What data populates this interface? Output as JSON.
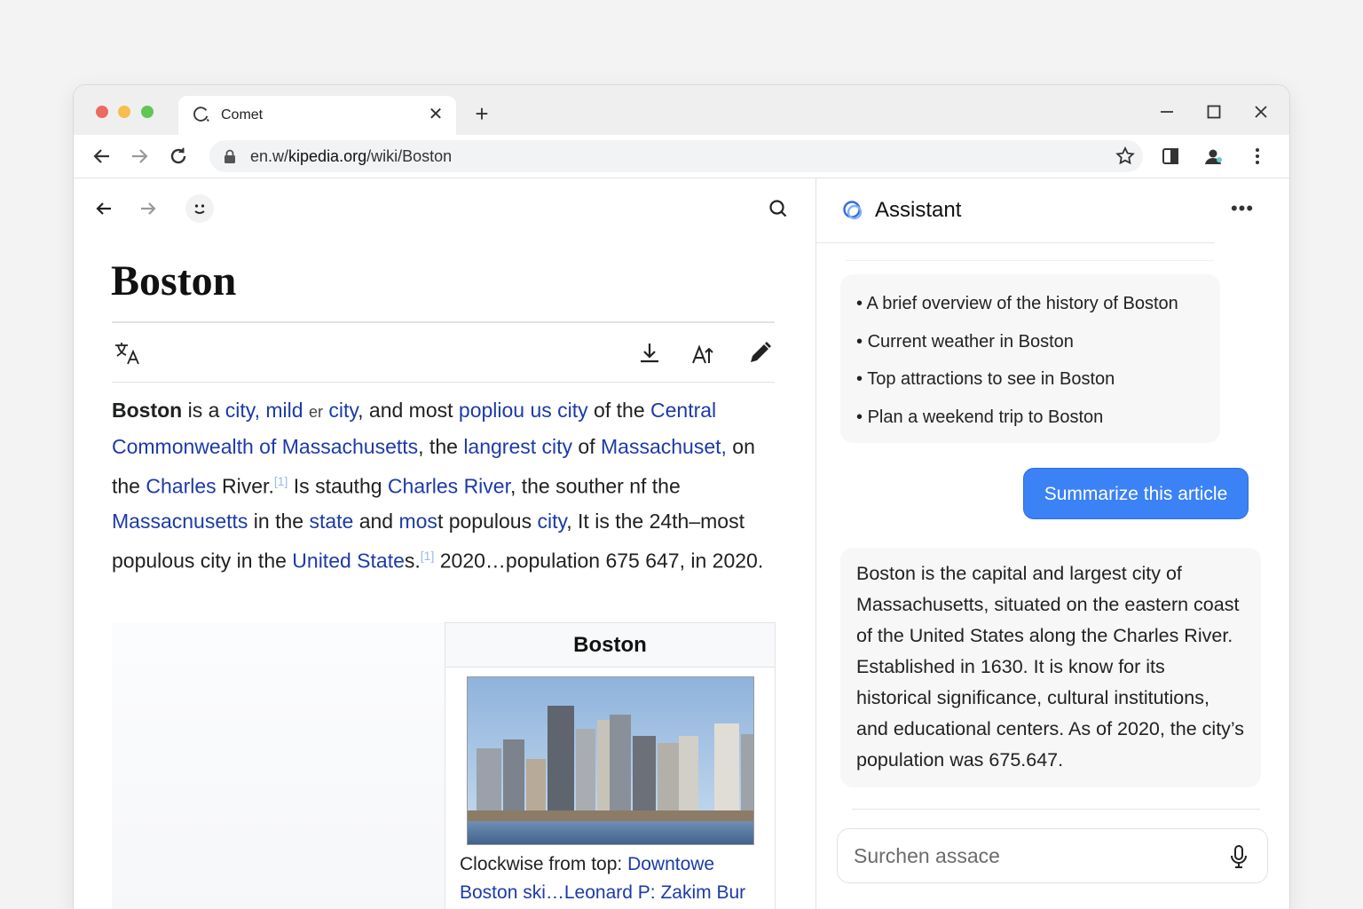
{
  "browser": {
    "tab_title": "Comet",
    "url_prefix": "en.w/",
    "url_domain": "kipedia.org",
    "url_path": "/wiki/Boston"
  },
  "article": {
    "title": "Boston",
    "p": [
      "Boston",
      " is a ",
      "city, mild",
      " ",
      "er",
      " ",
      "city",
      ", and most ",
      "popliou us city",
      " of the ",
      "Central Commonwealth of Massachusetts",
      ", the ",
      "langrest city",
      " of ",
      "Massachuset,",
      " on the ",
      "Charles",
      " River",
      ".",
      "[1]",
      " Is stauthg ",
      "Charles River",
      ", the souther nf the ",
      "Massacnusetts",
      " in the ",
      "state",
      " and ",
      "mos",
      "t populous ",
      "city",
      ", It is the 24th–most populous city in the ",
      "United State",
      "s.",
      "[1]",
      " 2020…population 675 647, in 2020."
    ],
    "infobox": {
      "title": "Boston",
      "caption_prefix": "Clockwise from top: ",
      "caption_link": "Downtowe Boston ski…Leonard P: Zakim Bur"
    }
  },
  "assistant": {
    "title": "Assistant",
    "suggestions": [
      "A brief overview of the history of Boston",
      "Current weather in Boston",
      "Top attractions to see in Boston",
      "Plan a weekend trip to Boston"
    ],
    "user_message": "Summarize this article",
    "answer": "Boston is the capital and largest city of Massachusetts, situated on the eastern coast of the United States along the Charles River. Established in 1630. It is know for its historical significance, cultural institutions, and educational centers. As of 2020, the city’s population was 675.647.",
    "search_placeholder": "Surchen assace"
  },
  "colors": {
    "link": "#1c3ba8",
    "accent": "#3b82f6"
  }
}
